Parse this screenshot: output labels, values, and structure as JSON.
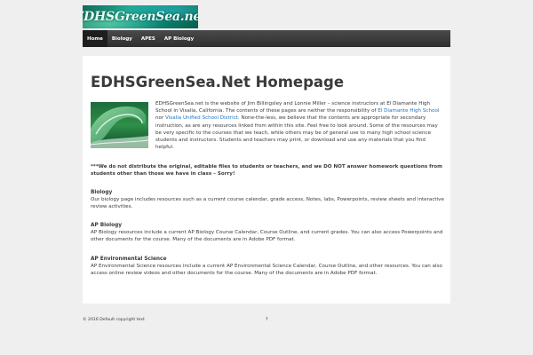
{
  "header": {
    "logo_text": "EDHSGreenSea.net"
  },
  "nav": {
    "items": [
      {
        "label": "Home"
      },
      {
        "label": "Biology"
      },
      {
        "label": "APES"
      },
      {
        "label": "AP Biology"
      }
    ]
  },
  "main": {
    "title": "EDHSGreenSea.Net Homepage",
    "intro": {
      "part1": "EDHSGreenSea.net is the website of Jim Billingsley and Lonnie Miller – science instructors at El Diamante High School in Visalia, California. The contents of these pages are neither the responsibility of ",
      "link1": "El Diamante High School",
      "part2": " nor ",
      "link2": "Visalia Unified School District",
      "part3": ". None-the-less, we believe that the contents are appropriate for secondary instruction, as are any resources linked from within this site. Feel free to look around. Some of the resources may be very specific to the courses that we teach, while others may be of general use to many high school science students and instructors. Students and teachers may print, or download and use any materials that you find helpful."
    },
    "notice": "***We do not distribute the original, editable files to students or teachers, and we DO NOT answer homework questions from students other than those we have in class – Sorry!",
    "sections": [
      {
        "heading": "Biology",
        "body": "Our biology page includes resources such as a current course calendar, grade access, Notes, labs, Powerpoints, review sheets and interactive review activities."
      },
      {
        "heading": "AP Biology",
        "body": "AP Biology resources include a current AP Biology Course Calendar, Course Outline, and current grades. You can also access Powerpoints and other documents for the course. Many of the documents are in Adobe PDF format."
      },
      {
        "heading": "AP Environmental Science",
        "body": "AP Environmental Science resources include a current AP Environmental Science Calendar, Course Outline, and other resources. You can also access online review videos and other documents for the course. Many of the documents are in Adobe PDF format."
      }
    ]
  },
  "footer": {
    "copyright": "© 2016 Default copyright text",
    "back_to_top": "↑"
  },
  "colors": {
    "link": "#1e73be",
    "nav_bg": "#333333",
    "page_bg": "#efefef"
  }
}
